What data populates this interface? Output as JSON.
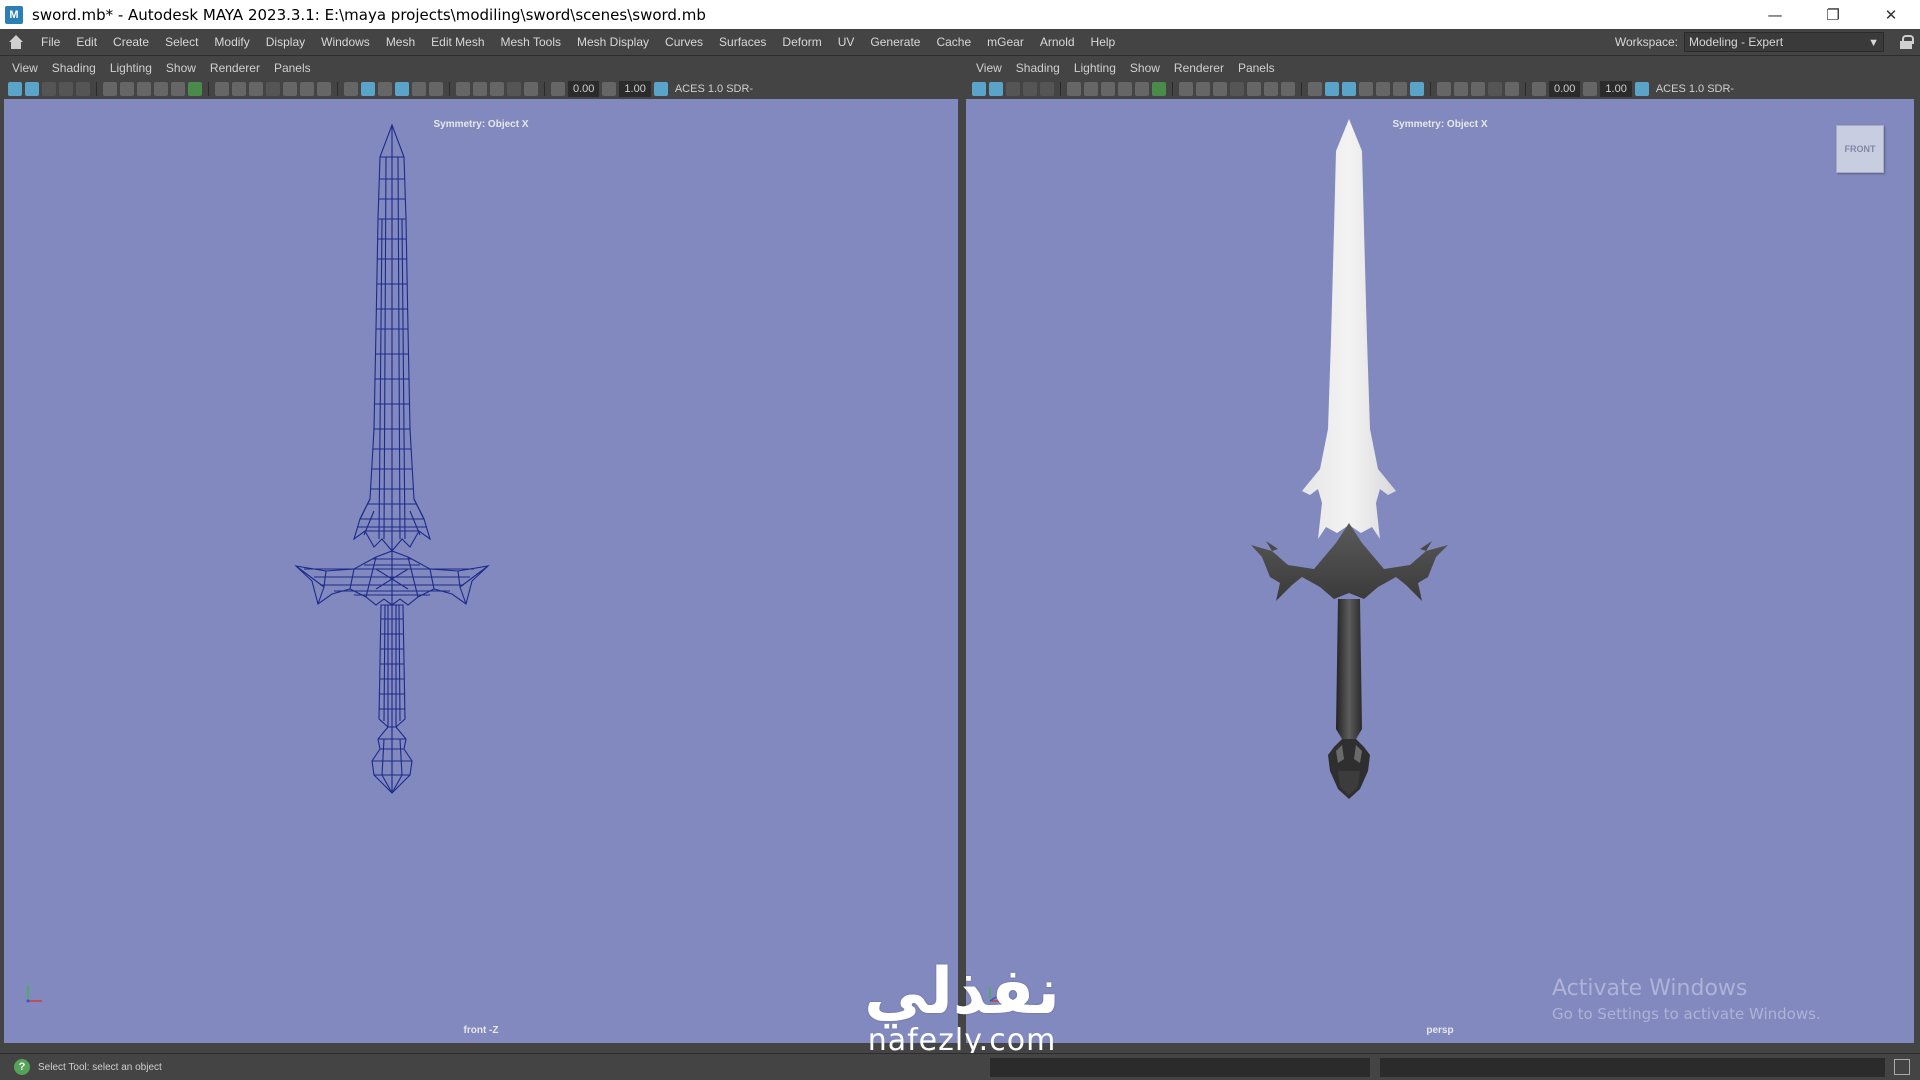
{
  "window": {
    "app_icon": "M",
    "title": "sword.mb* - Autodesk MAYA 2023.3.1: E:\\maya projects\\modiling\\sword\\scenes\\sword.mb",
    "minimize": "—",
    "restore": "❐",
    "close": "✕"
  },
  "menu": {
    "items": [
      "File",
      "Edit",
      "Create",
      "Select",
      "Modify",
      "Display",
      "Windows",
      "Mesh",
      "Edit Mesh",
      "Mesh Tools",
      "Mesh Display",
      "Curves",
      "Surfaces",
      "Deform",
      "UV",
      "Generate",
      "Cache",
      "mGear",
      "Arnold",
      "Help"
    ],
    "workspace_label": "Workspace:",
    "workspace_value": "Modeling - Expert"
  },
  "panels": {
    "menu_items": [
      "View",
      "Shading",
      "Lighting",
      "Show",
      "Renderer",
      "Panels"
    ],
    "left": {
      "exposure": "0.00",
      "gamma": "1.00",
      "color_space": "ACES 1.0 SDR-",
      "symmetry": "Symmetry: Object X",
      "camera": "front -Z"
    },
    "right": {
      "exposure": "0.00",
      "gamma": "1.00",
      "color_space": "ACES 1.0 SDR-",
      "symmetry": "Symmetry: Object X",
      "camera": "persp",
      "viewcube_face": "FRONT"
    }
  },
  "colors": {
    "viewport_bg": "#8189bf",
    "wireframe": "#1d2a8a",
    "ui_bg": "#444444"
  },
  "icons": {
    "home": "home-icon",
    "lock": "lock-icon",
    "help": "help-circle-icon"
  },
  "watermark": {
    "title": "Activate Windows",
    "subtitle": "Go to Settings to activate Windows."
  },
  "brand": {
    "arabic": "نفذلي",
    "latin": "nafezly.com"
  },
  "helpline": {
    "text": "Select Tool: select an object",
    "help_glyph": "?"
  }
}
